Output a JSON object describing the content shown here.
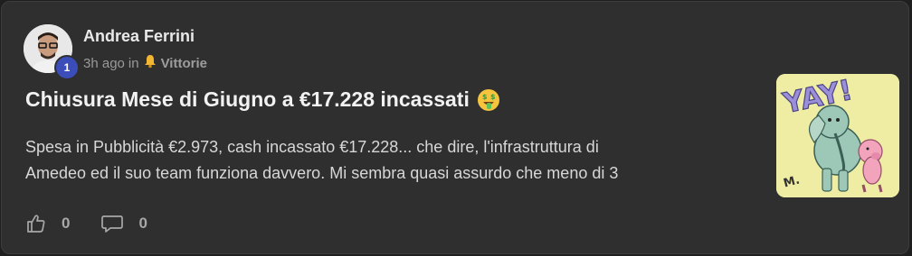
{
  "post": {
    "author": "Andrea Ferrini",
    "level": "1",
    "time_ago": "3h ago",
    "in_word": "in",
    "category_icon": "bell-emoji",
    "category": "Vittorie",
    "title": "Chiusura Mese di Giugno a €17.228 incassati",
    "title_emoji": "money-mouth-face",
    "body_line_1": "Spesa in Pubblicità €2.973, cash incassato €17.228... che dire, l'infrastruttura di",
    "body_line_2": "Amedeo ed il suo team funziona davvero. Mi sembra quasi assurdo che meno di 3",
    "likes": "0",
    "comments": "0",
    "thumbnail_text": "YAY!"
  },
  "colors": {
    "card_bg": "#2f2f30",
    "level_badge": "#3b4db8",
    "thumbnail_bg": "#eeeda3"
  }
}
